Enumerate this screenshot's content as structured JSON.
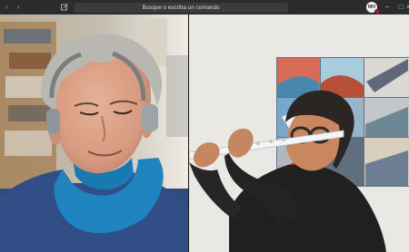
{
  "titlebar": {
    "search_placeholder": "Busque o escriba un comando",
    "avatar_initials": "MH",
    "icons": [
      "back-icon",
      "forward-icon",
      "compose-icon",
      "minimize-icon",
      "maximize-icon",
      "close-icon"
    ]
  },
  "colors": {
    "titlebar_bg": "#2d2c2c",
    "search_bg": "#3c3b3b",
    "presence_dot": "#c50f1f"
  }
}
